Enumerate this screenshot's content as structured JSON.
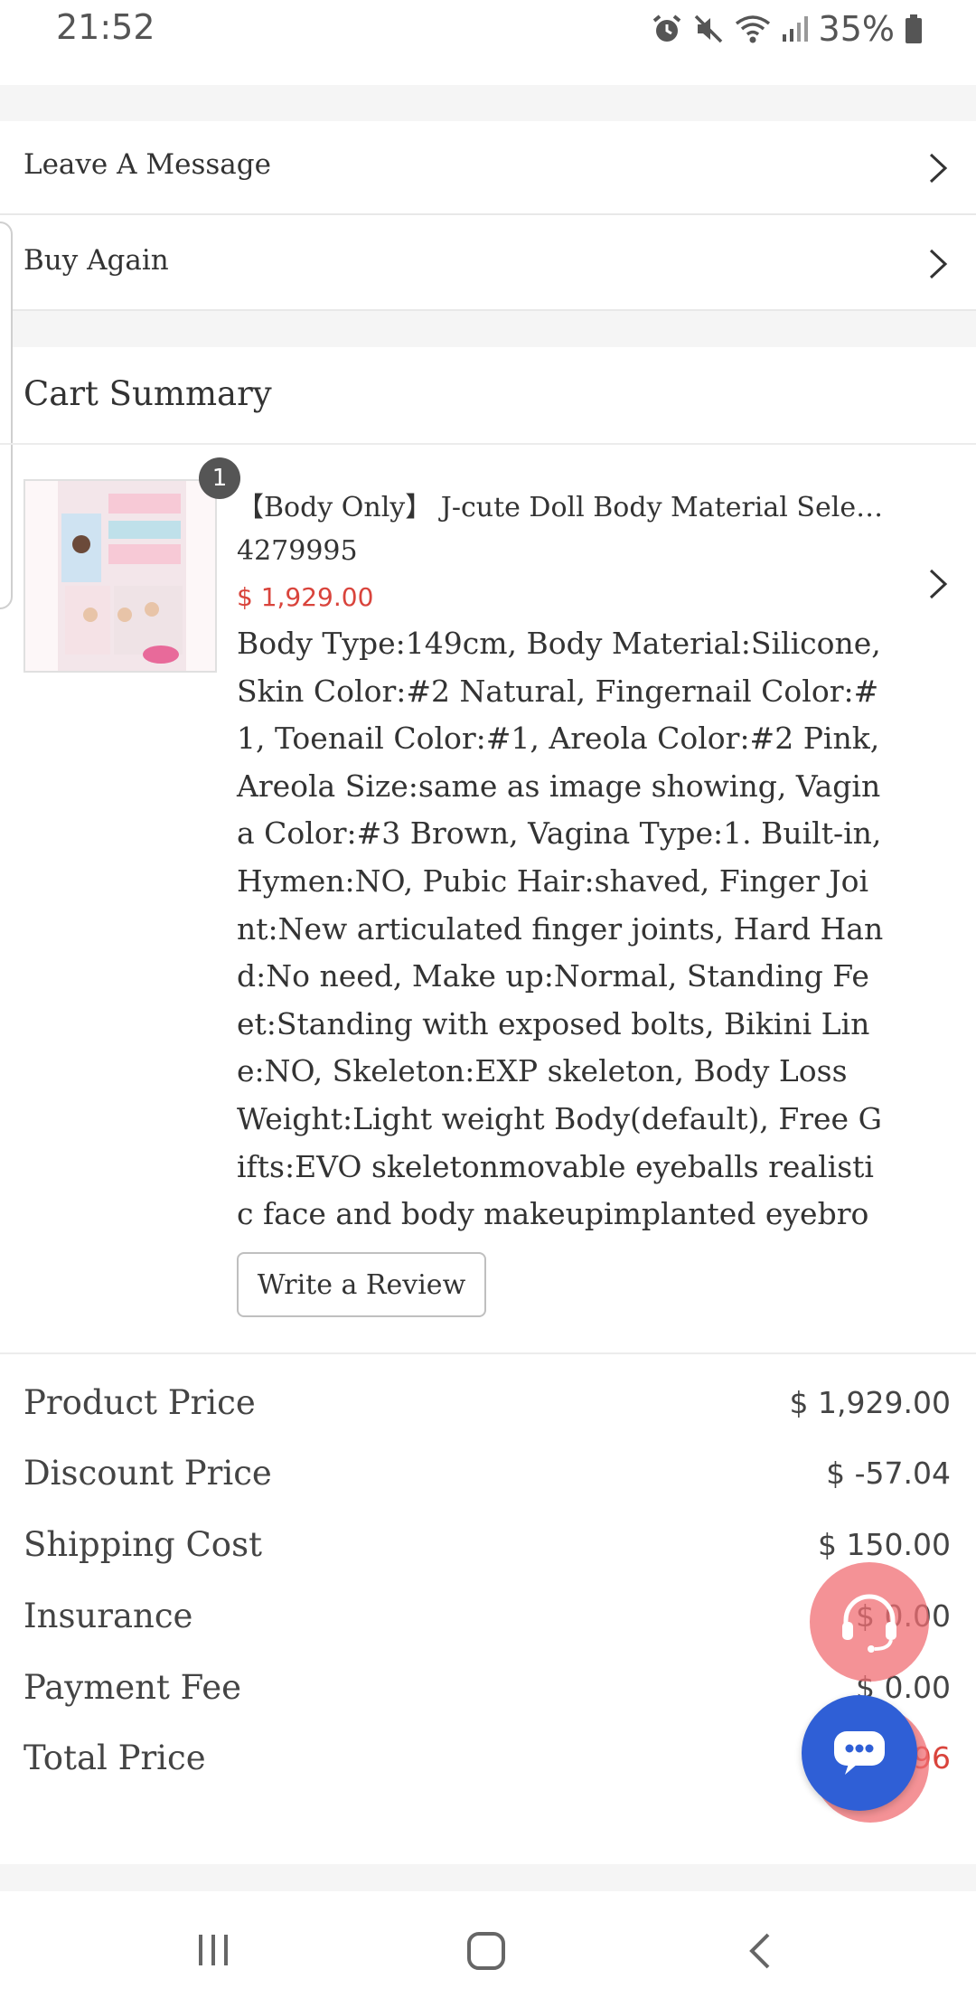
{
  "status_bar": {
    "time": "21:52",
    "battery": "35%",
    "icons": [
      "alarm-icon",
      "mute-icon",
      "wifi-icon",
      "signal-icon",
      "battery-icon"
    ]
  },
  "menu": {
    "leave_message": "Leave A Message",
    "buy_again": "Buy Again"
  },
  "cart": {
    "title": "Cart Summary",
    "item": {
      "quantity": "1",
      "title": "【Body Only】 J-cute Doll Body Material Select…",
      "code": "4279995",
      "price": "$ 1,929.00",
      "options": "Body Type:149cm, Body Material:Silicone, Skin Color:#2 Natural, Fingernail Color:#1, Toenail Color:#1, Areola Color:#2 Pink, Areola Size:same as image showing, Vagina Color:#3 Brown, Vagina Type:1. Built-in, Hymen:NO, Pubic Hair:shaved, Finger Joint:New articulated finger joints, Hard Hand:No need, Make up:Normal, Standing Feet:Standing with exposed bolts, Bikini Line:NO, Skeleton:EXP skeleton, Body Loss Weight:Light weight Body(default), Free Gifts:EVO skeletonmovable eyeballs realistic face and body makeupimplanted eyebrow",
      "review_button": "Write a Review"
    }
  },
  "summary": {
    "product_price": {
      "label": "Product Price",
      "value": "$ 1,929.00"
    },
    "discount_price": {
      "label": "Discount Price",
      "value": "$ -57.04"
    },
    "shipping_cost": {
      "label": "Shipping Cost",
      "value": "$ 150.00"
    },
    "insurance": {
      "label": "Insurance",
      "value": "$ 0.00"
    },
    "payment_fee": {
      "label": "Payment Fee",
      "value": "$ 0.00"
    },
    "total_price": {
      "label": "Total Price",
      "value": "96"
    }
  },
  "colors": {
    "accent_red": "#d9443c",
    "chat_blue": "#2f5fd6",
    "support_pink": "#f06e73"
  }
}
